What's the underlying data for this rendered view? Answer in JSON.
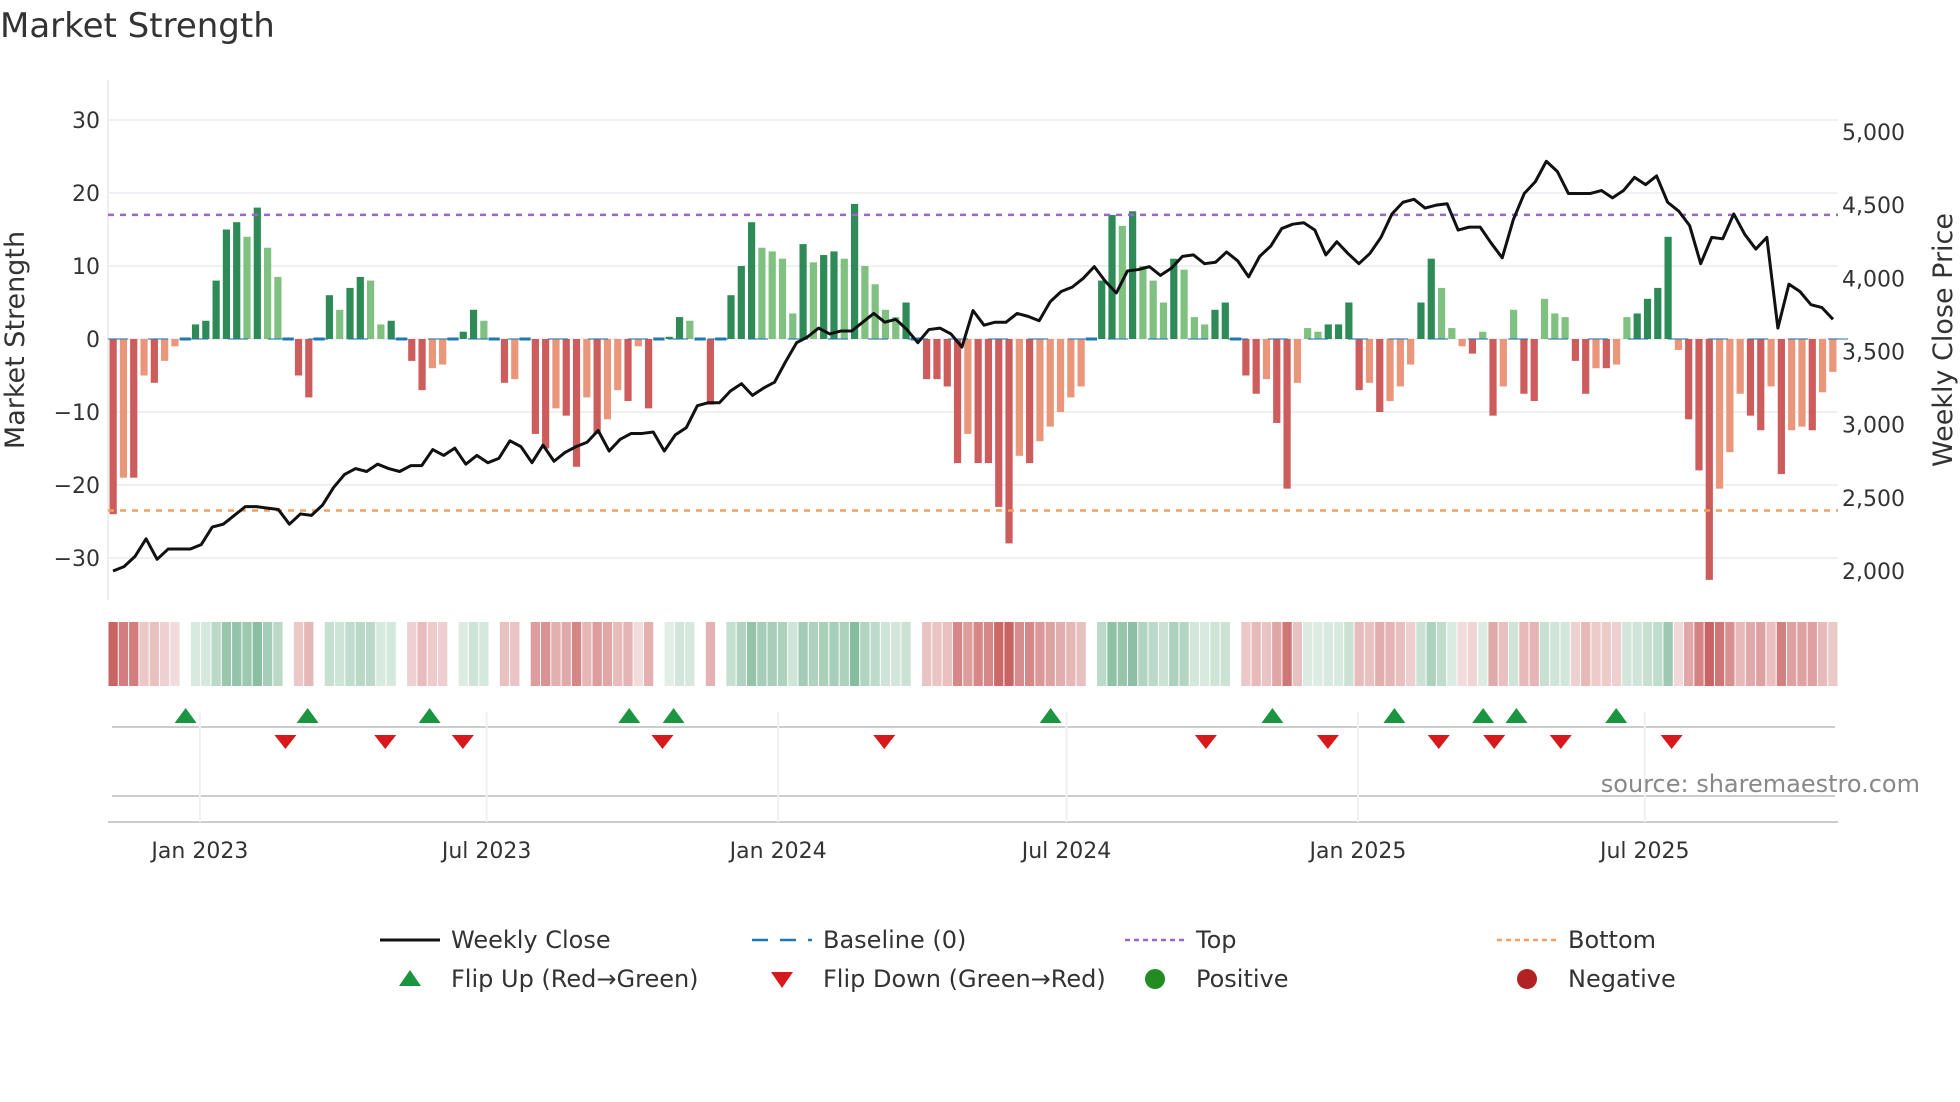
{
  "title": "Market Strength",
  "source": "source: sharemaestro.com",
  "colors": {
    "pos_strong": "#2e8b57",
    "pos_weak": "#80c080",
    "neg_strong": "#cd5c5c",
    "neg_weak": "#e9967a",
    "top": "#9966cc",
    "bottom": "#f0a060",
    "baseline": "#1f77b4",
    "up": "#1a9641",
    "down": "#d7191c",
    "line": "#111111"
  },
  "chart_data": {
    "type": "bar",
    "title": "Market Strength",
    "ylabel": "Market Strength",
    "y2label": "Weekly Close Price",
    "ylim": [
      -35,
      35
    ],
    "y2lim": [
      1850,
      5270
    ],
    "yticks": [
      30,
      20,
      10,
      0,
      -10,
      -20,
      -30
    ],
    "y2ticks": [
      "2,000",
      "2,500",
      "3,000",
      "3,500",
      "4,000",
      "4,500",
      "5,000"
    ],
    "y2tickvals": [
      2000,
      2500,
      3000,
      3500,
      4000,
      4500,
      5000
    ],
    "xdomain": [
      "2022-11-04",
      "2025-10-31"
    ],
    "xticks": [
      {
        "date": "2023-01-01",
        "label": "Jan 2023"
      },
      {
        "date": "2023-07-01",
        "label": "Jul 2023"
      },
      {
        "date": "2024-01-01",
        "label": "Jan 2024"
      },
      {
        "date": "2024-07-01",
        "label": "Jul 2024"
      },
      {
        "date": "2025-01-01",
        "label": "Jan 2025"
      },
      {
        "date": "2025-07-01",
        "label": "Jul 2025"
      }
    ],
    "top": 17,
    "bottom": -23.5,
    "strength": [
      -24,
      -19,
      -19,
      -5,
      -6,
      -3,
      -1,
      0,
      2,
      2.5,
      8,
      15,
      16,
      14,
      18,
      12.5,
      8.5,
      0,
      -5,
      -8,
      0,
      6,
      4,
      7,
      8.5,
      8,
      2,
      2.5,
      0,
      -3,
      -7,
      -4,
      -3.5,
      0,
      1,
      4,
      2.5,
      0,
      -6,
      -5.5,
      0,
      -13,
      -15,
      -9.5,
      -10.5,
      -17.5,
      -8,
      -13,
      -11,
      -7,
      -8.5,
      -1,
      -9.5,
      0,
      0.3,
      3,
      2.5,
      0,
      -9,
      0,
      6,
      10,
      16,
      12.5,
      12,
      11,
      3.5,
      13,
      10.5,
      11.5,
      12,
      11,
      18.5,
      10,
      7.5,
      4,
      3,
      5,
      0,
      -5.5,
      -5.5,
      -6.5,
      -17,
      -13,
      -17,
      -17,
      -23,
      -28,
      -16,
      -17,
      -14,
      -12,
      -10,
      -8,
      -6.5,
      0,
      8,
      17,
      15.5,
      17.5,
      10,
      8,
      5,
      11,
      9.5,
      3,
      2,
      4,
      5,
      0,
      -5,
      -7.5,
      -5.5,
      -11.5,
      -20.5,
      -6,
      1.5,
      1,
      2,
      2,
      5,
      -7,
      -6,
      -10,
      -8.5,
      -6.5,
      -3.5,
      5,
      11,
      7,
      1.5,
      -1,
      -2,
      1,
      -10.5,
      -6.5,
      4,
      -7.5,
      -8.5,
      5.5,
      3.5,
      3,
      -3,
      -7.5,
      -4,
      -4,
      -3.5,
      3,
      3.5,
      5.5,
      7,
      14,
      -1.5,
      -11,
      -18,
      -33,
      -20.5,
      -15.5,
      -7.5,
      -10.5,
      -12.5,
      -6.5,
      -18.5,
      -12.5,
      -12,
      -12.5,
      -7.3,
      -4.5
    ],
    "weekly_close": [
      2000,
      2030,
      2100,
      2220,
      2080,
      2150,
      2150,
      2150,
      2180,
      2300,
      2320,
      2380,
      2440,
      2440,
      2430,
      2420,
      2320,
      2390,
      2380,
      2450,
      2570,
      2660,
      2700,
      2680,
      2730,
      2700,
      2680,
      2720,
      2720,
      2830,
      2790,
      2840,
      2730,
      2790,
      2740,
      2770,
      2890,
      2850,
      2740,
      2860,
      2750,
      2810,
      2850,
      2880,
      2960,
      2820,
      2900,
      2940,
      2940,
      2950,
      2820,
      2930,
      2980,
      3130,
      3150,
      3150,
      3230,
      3280,
      3200,
      3250,
      3290,
      3430,
      3560,
      3600,
      3660,
      3620,
      3640,
      3640,
      3700,
      3760,
      3700,
      3720,
      3650,
      3560,
      3650,
      3660,
      3620,
      3530,
      3780,
      3680,
      3700,
      3700,
      3760,
      3740,
      3710,
      3840,
      3910,
      3940,
      4000,
      4080,
      3980,
      3900,
      4050,
      4060,
      4080,
      4020,
      4070,
      4150,
      4160,
      4100,
      4110,
      4180,
      4120,
      4010,
      4150,
      4220,
      4340,
      4370,
      4380,
      4330,
      4160,
      4250,
      4170,
      4100,
      4170,
      4280,
      4440,
      4520,
      4540,
      4480,
      4500,
      4510,
      4330,
      4350,
      4350,
      4240,
      4140,
      4400,
      4580,
      4660,
      4800,
      4730,
      4580,
      4580,
      4580,
      4600,
      4550,
      4600,
      4690,
      4640,
      4700,
      4520,
      4460,
      4360,
      4100,
      4280,
      4270,
      4440,
      4300,
      4200,
      4280,
      3660,
      3960,
      3910,
      3820,
      3800,
      3720
    ],
    "flip_up": [
      "2022-12-23",
      "2023-03-10",
      "2023-05-26",
      "2023-09-29",
      "2023-10-27",
      "2024-06-21",
      "2024-11-08",
      "2025-01-24",
      "2025-03-21",
      "2025-04-11",
      "2025-06-13"
    ],
    "flip_down": [
      "2023-02-24",
      "2023-04-28",
      "2023-06-16",
      "2023-10-20",
      "2024-03-08",
      "2024-09-27",
      "2024-12-13",
      "2025-02-21",
      "2025-03-28",
      "2025-05-09",
      "2025-07-18"
    ],
    "legend": {
      "placement": "bottom",
      "items": [
        "Weekly Close",
        "Baseline (0)",
        "Top",
        "Bottom",
        "Flip Up (Red→Green)",
        "Flip Down (Green→Red)",
        "Positive",
        "Negative"
      ]
    }
  }
}
